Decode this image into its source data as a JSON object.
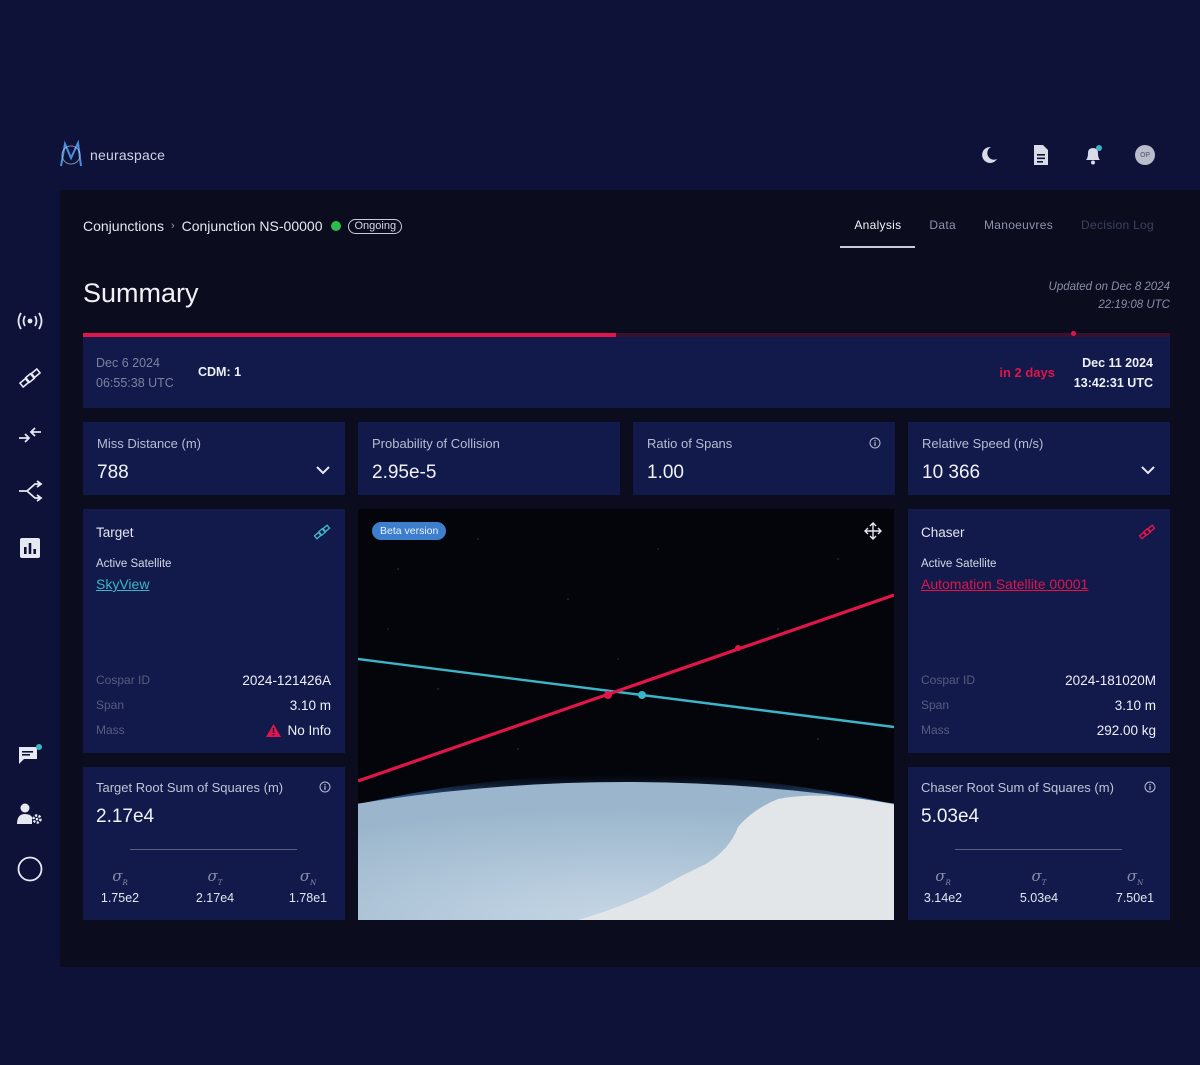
{
  "app": {
    "name": "neuraspace"
  },
  "breadcrumb": {
    "root": "Conjunctions",
    "current": "Conjunction NS-00000",
    "status": "Ongoing"
  },
  "tabs": [
    {
      "label": "Analysis",
      "state": "active"
    },
    {
      "label": "Data",
      "state": "normal"
    },
    {
      "label": "Manoeuvres",
      "state": "normal"
    },
    {
      "label": "Decision Log",
      "state": "disabled"
    }
  ],
  "summary": {
    "title": "Summary",
    "updated_line1": "Updated on Dec 8 2024",
    "updated_line2": "22:19:08 UTC"
  },
  "timeline": {
    "progress_fraction": 0.49,
    "start_date": "Dec 6 2024",
    "start_time": "06:55:38 UTC",
    "cdm": "CDM: 1",
    "countdown": "in 2 days",
    "end_date": "Dec 11 2024",
    "end_time": "13:42:31 UTC"
  },
  "metrics": {
    "miss_distance": {
      "label": "Miss Distance (m)",
      "value": "788"
    },
    "probability": {
      "label": "Probability of Collision",
      "value": "2.95e-5"
    },
    "ratio_spans": {
      "label": "Ratio of Spans",
      "value": "1.00"
    },
    "relative_speed": {
      "label": "Relative Speed (m/s)",
      "value": "10 366"
    }
  },
  "target": {
    "title": "Target",
    "type": "Active Satellite",
    "name": "SkyView",
    "cospar_label": "Cospar ID",
    "cospar": "2024-121426A",
    "span_label": "Span",
    "span": "3.10 m",
    "mass_label": "Mass",
    "mass": "No Info",
    "rss": {
      "label": "Target Root Sum of Squares (m)",
      "value": "2.17e4",
      "s1": "1.75e2",
      "s2": "2.17e4",
      "s3": "1.78e1"
    }
  },
  "chaser": {
    "title": "Chaser",
    "type": "Active Satellite",
    "name": "Automation Satellite 00001",
    "cospar_label": "Cospar ID",
    "cospar": "2024-181020M",
    "span_label": "Span",
    "span": "3.10 m",
    "mass_label": "Mass",
    "mass": "292.00 kg",
    "rss": {
      "label": "Chaser Root Sum of Squares (m)",
      "value": "5.03e4",
      "s1": "3.14e2",
      "s2": "5.03e4",
      "s3": "7.50e1"
    }
  },
  "sigma_labels": {
    "r": "R",
    "t": "T",
    "n": "N"
  },
  "viewer": {
    "badge": "Beta version"
  },
  "colors": {
    "accent_red": "#e0154a",
    "accent_teal": "#3ab6c8",
    "card_bg": "#111a4a",
    "status_green": "#2dbb4c"
  }
}
